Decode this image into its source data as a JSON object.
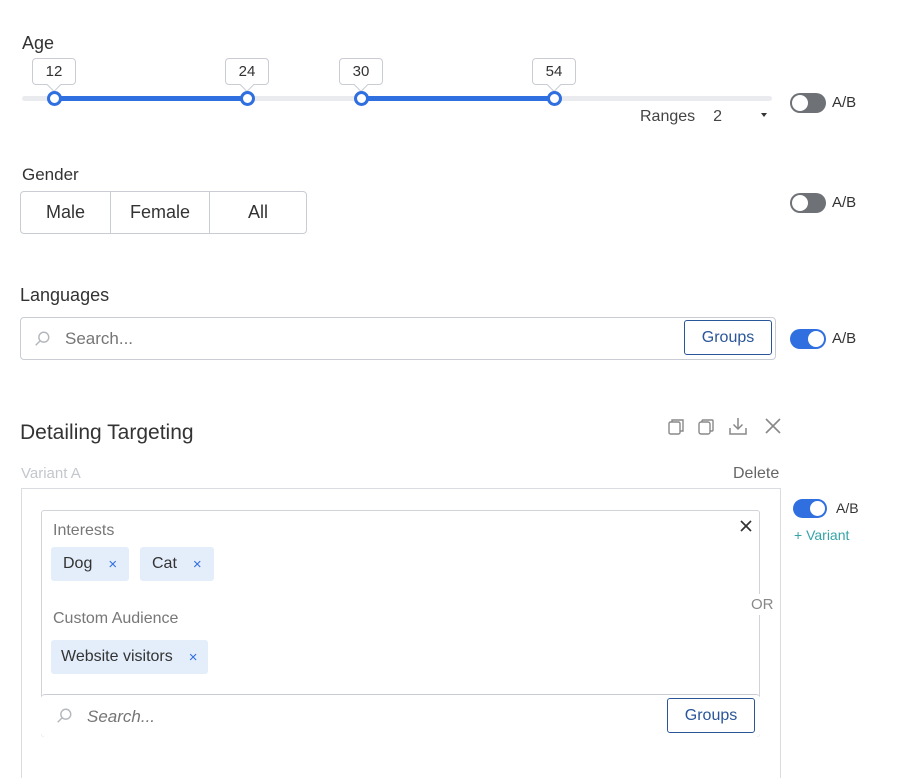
{
  "age": {
    "label": "Age",
    "handles": [
      12,
      24,
      30,
      54
    ],
    "ranges_label": "Ranges",
    "ranges_value": "2"
  },
  "gender": {
    "label": "Gender",
    "options": [
      "Male",
      "Female",
      "All"
    ]
  },
  "languages": {
    "label": "Languages",
    "search_placeholder": "Search...",
    "groups_label": "Groups"
  },
  "ab_label": "A/B",
  "detailing": {
    "title": "Detailing Targeting",
    "variant_label": "Variant A",
    "delete_label": "Delete",
    "add_variant_label": "+ Variant",
    "or_label": "OR",
    "interests_label": "Interests",
    "interests": [
      "Dog",
      "Cat"
    ],
    "custom_audience_label": "Custom Audience",
    "custom_audiences": [
      "Website visitors"
    ],
    "search_placeholder": "Search...",
    "groups_label": "Groups",
    "chip_remove": "×"
  },
  "colors": {
    "accent": "#2f6fe0",
    "toggle_off": "#6e7176",
    "chip_bg": "#e4eefb",
    "variant_link": "#35a4a8"
  }
}
